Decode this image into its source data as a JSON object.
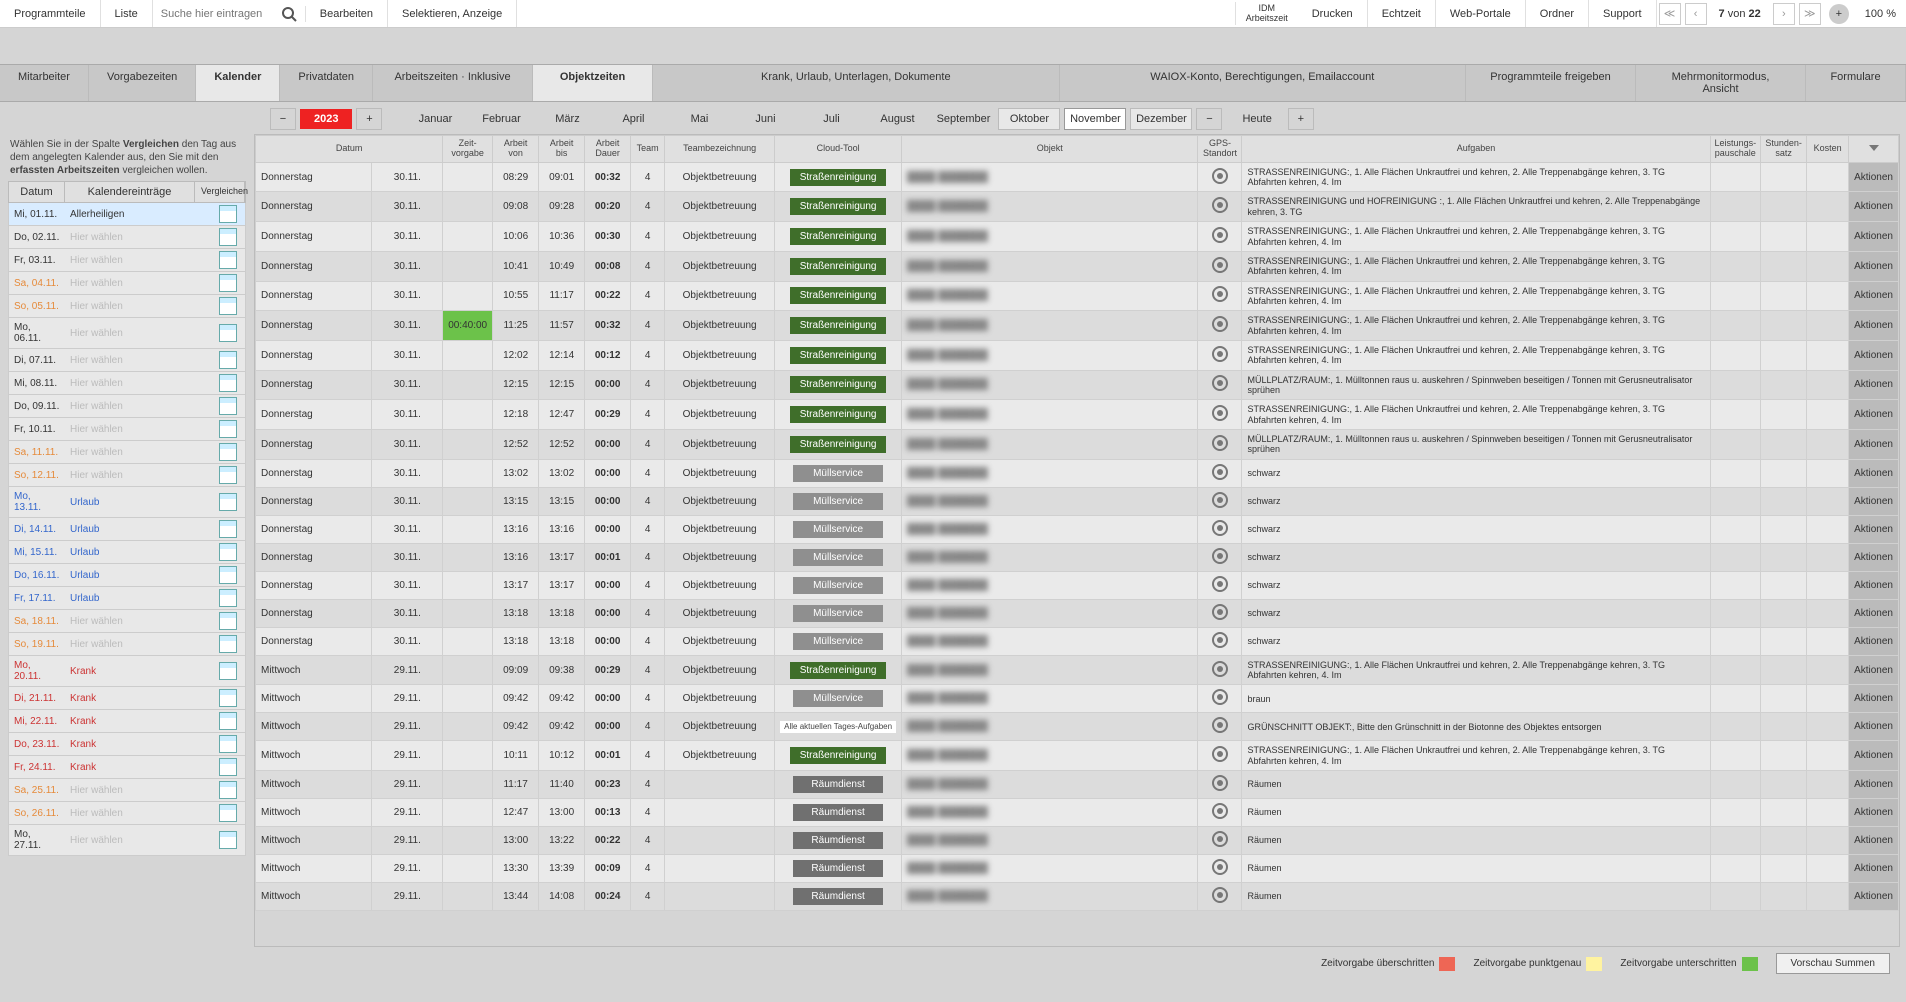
{
  "toolbar": {
    "programmteile": "Programmteile",
    "liste": "Liste",
    "search_placeholder": "Suche hier eintragen",
    "bearbeiten": "Bearbeiten",
    "selektieren": "Selektieren, Anzeige",
    "idm_line1": "IDM",
    "idm_line2": "Arbeitszeit",
    "drucken": "Drucken",
    "echtzeit": "Echtzeit",
    "webportale": "Web-Portale",
    "ordner": "Ordner",
    "support": "Support",
    "page_current": "7",
    "page_von": "von",
    "page_total": "22",
    "zoom": "100 %"
  },
  "tabs": {
    "mitarbeiter": "Mitarbeiter",
    "vorgabezeiten": "Vorgabezeiten",
    "kalender": "Kalender",
    "privatdaten": "Privatdaten",
    "arbeitszeiten": "Arbeitszeiten · Inklusive",
    "objektzeiten": "Objektzeiten",
    "krank": "Krank, Urlaub, Unterlagen, Dokumente",
    "waiox": "WAIOX-Konto, Berechtigungen, Emailaccount",
    "progfrei": "Programmteile freigeben",
    "mehrmonitor": "Mehrmonitormodus, Ansicht",
    "formulare": "Formulare"
  },
  "months": {
    "year": "2023",
    "januar": "Januar",
    "februar": "Februar",
    "maerz": "März",
    "april": "April",
    "mai": "Mai",
    "juni": "Juni",
    "juli": "Juli",
    "august": "August",
    "september": "September",
    "oktober": "Oktober",
    "november": "November",
    "dezember": "Dezember",
    "heute": "Heute"
  },
  "left": {
    "desc_pre": "Wählen Sie in der Spalte ",
    "desc_b1": "Vergleichen",
    "desc_mid": " den Tag aus dem angelegten Kalender aus, den Sie mit den ",
    "desc_b2": "erfassten Arbeitszeiten",
    "desc_post": " vergleichen wollen.",
    "col_datum": "Datum",
    "col_entry": "Kalendereinträge",
    "col_vgl": "Vergleichen",
    "hint": "Hier wählen",
    "rows": [
      {
        "d": "Mi, 01.11.",
        "e": "Allerheiligen",
        "cls": "",
        "hl": true
      },
      {
        "d": "Do, 02.11.",
        "e": "",
        "cls": ""
      },
      {
        "d": "Fr, 03.11.",
        "e": "",
        "cls": ""
      },
      {
        "d": "Sa, 04.11.",
        "e": "",
        "cls": "wkend"
      },
      {
        "d": "So, 05.11.",
        "e": "",
        "cls": "wkend"
      },
      {
        "d": "Mo, 06.11.",
        "e": "",
        "cls": ""
      },
      {
        "d": "Di, 07.11.",
        "e": "",
        "cls": ""
      },
      {
        "d": "Mi, 08.11.",
        "e": "",
        "cls": ""
      },
      {
        "d": "Do, 09.11.",
        "e": "",
        "cls": ""
      },
      {
        "d": "Fr, 10.11.",
        "e": "",
        "cls": ""
      },
      {
        "d": "Sa, 11.11.",
        "e": "",
        "cls": "wkend"
      },
      {
        "d": "So, 12.11.",
        "e": "",
        "cls": "wkend"
      },
      {
        "d": "Mo, 13.11.",
        "e": "Urlaub",
        "cls": "urlaub"
      },
      {
        "d": "Di, 14.11.",
        "e": "Urlaub",
        "cls": "urlaub"
      },
      {
        "d": "Mi, 15.11.",
        "e": "Urlaub",
        "cls": "urlaub"
      },
      {
        "d": "Do, 16.11.",
        "e": "Urlaub",
        "cls": "urlaub"
      },
      {
        "d": "Fr, 17.11.",
        "e": "Urlaub",
        "cls": "urlaub"
      },
      {
        "d": "Sa, 18.11.",
        "e": "",
        "cls": "wkend"
      },
      {
        "d": "So, 19.11.",
        "e": "",
        "cls": "wkend"
      },
      {
        "d": "Mo, 20.11.",
        "e": "Krank",
        "cls": "krank"
      },
      {
        "d": "Di, 21.11.",
        "e": "Krank",
        "cls": "krank"
      },
      {
        "d": "Mi, 22.11.",
        "e": "Krank",
        "cls": "krank"
      },
      {
        "d": "Do, 23.11.",
        "e": "Krank",
        "cls": "krank"
      },
      {
        "d": "Fr, 24.11.",
        "e": "Krank",
        "cls": "krank"
      },
      {
        "d": "Sa, 25.11.",
        "e": "",
        "cls": "wkend"
      },
      {
        "d": "So, 26.11.",
        "e": "",
        "cls": "wkend"
      },
      {
        "d": "Mo, 27.11.",
        "e": "",
        "cls": ""
      }
    ]
  },
  "hdr": {
    "datum": "Datum",
    "zvg": "Zeit-\nvorgabe",
    "avon": "Arbeit\nvon",
    "abis": "Arbeit\nbis",
    "adauer": "Arbeit\nDauer",
    "team": "Team",
    "teambez": "Teambezeichnung",
    "cloud": "Cloud-Tool",
    "objekt": "Objekt",
    "gps": "GPS-\nStandort",
    "aufgaben": "Aufgaben",
    "lp": "Leistungs-\npauschale",
    "ss": "Stunden-\nsatz",
    "kosten": "Kosten",
    "akt": "Aktionen"
  },
  "grid": {
    "rows": [
      {
        "tag": "Donnerstag",
        "dat": "30.11.",
        "zvg": "",
        "von": "08:29",
        "bis": "09:01",
        "dauer": "00:32",
        "team": "4",
        "tb": "Objektbetreuung",
        "tool": "strasse",
        "tool_lbl": "Straßenreinigung",
        "auf": "STRASSENREINIGUNG:, 1. Alle Flächen Unkrautfrei und kehren, 2. Alle Treppenabgänge kehren, 3. TG Abfahrten kehren, 4. Im"
      },
      {
        "tag": "Donnerstag",
        "dat": "30.11.",
        "zvg": "",
        "von": "09:08",
        "bis": "09:28",
        "dauer": "00:20",
        "team": "4",
        "tb": "Objektbetreuung",
        "tool": "strasse",
        "tool_lbl": "Straßenreinigung",
        "auf": "STRASSENREINIGUNG und HOFREINIGUNG :, 1. Alle Flächen Unkrautfrei und kehren, 2. Alle Treppenabgänge kehren, 3. TG"
      },
      {
        "tag": "Donnerstag",
        "dat": "30.11.",
        "zvg": "",
        "von": "10:06",
        "bis": "10:36",
        "dauer": "00:30",
        "team": "4",
        "tb": "Objektbetreuung",
        "tool": "strasse",
        "tool_lbl": "Straßenreinigung",
        "auf": "STRASSENREINIGUNG:, 1. Alle Flächen Unkrautfrei und kehren, 2. Alle Treppenabgänge kehren, 3. TG Abfahrten kehren, 4. Im"
      },
      {
        "tag": "Donnerstag",
        "dat": "30.11.",
        "zvg": "",
        "von": "10:41",
        "bis": "10:49",
        "dauer": "00:08",
        "team": "4",
        "tb": "Objektbetreuung",
        "tool": "strasse",
        "tool_lbl": "Straßenreinigung",
        "auf": "STRASSENREINIGUNG:, 1. Alle Flächen Unkrautfrei und kehren, 2. Alle Treppenabgänge kehren, 3. TG Abfahrten kehren, 4. Im"
      },
      {
        "tag": "Donnerstag",
        "dat": "30.11.",
        "zvg": "",
        "von": "10:55",
        "bis": "11:17",
        "dauer": "00:22",
        "team": "4",
        "tb": "Objektbetreuung",
        "tool": "strasse",
        "tool_lbl": "Straßenreinigung",
        "auf": "STRASSENREINIGUNG:, 1. Alle Flächen Unkrautfrei und kehren, 2. Alle Treppenabgänge kehren, 3. TG Abfahrten kehren, 4. Im"
      },
      {
        "tag": "Donnerstag",
        "dat": "30.11.",
        "zvg": "00:40:00",
        "von": "11:25",
        "bis": "11:57",
        "dauer": "00:32",
        "team": "4",
        "tb": "Objektbetreuung",
        "tool": "strasse",
        "tool_lbl": "Straßenreinigung",
        "auf": "STRASSENREINIGUNG:, 1. Alle Flächen Unkrautfrei und kehren, 2. Alle Treppenabgänge kehren, 3. TG Abfahrten kehren, 4. Im",
        "zvghl": true
      },
      {
        "tag": "Donnerstag",
        "dat": "30.11.",
        "zvg": "",
        "von": "12:02",
        "bis": "12:14",
        "dauer": "00:12",
        "team": "4",
        "tb": "Objektbetreuung",
        "tool": "strasse",
        "tool_lbl": "Straßenreinigung",
        "auf": "STRASSENREINIGUNG:, 1. Alle Flächen Unkrautfrei und kehren, 2. Alle Treppenabgänge kehren, 3. TG Abfahrten kehren, 4. Im"
      },
      {
        "tag": "Donnerstag",
        "dat": "30.11.",
        "zvg": "",
        "von": "12:15",
        "bis": "12:15",
        "dauer": "00:00",
        "team": "4",
        "tb": "Objektbetreuung",
        "tool": "strasse",
        "tool_lbl": "Straßenreinigung",
        "auf": "MÜLLPLATZ/RAUM:, 1. Mülltonnen raus u. auskehren / Spinnweben beseitigen / Tonnen mit Gerusneutralisator sprühen"
      },
      {
        "tag": "Donnerstag",
        "dat": "30.11.",
        "zvg": "",
        "von": "12:18",
        "bis": "12:47",
        "dauer": "00:29",
        "team": "4",
        "tb": "Objektbetreuung",
        "tool": "strasse",
        "tool_lbl": "Straßenreinigung",
        "auf": "STRASSENREINIGUNG:, 1. Alle Flächen Unkrautfrei und kehren, 2. Alle Treppenabgänge kehren, 3. TG Abfahrten kehren, 4. Im"
      },
      {
        "tag": "Donnerstag",
        "dat": "30.11.",
        "zvg": "",
        "von": "12:52",
        "bis": "12:52",
        "dauer": "00:00",
        "team": "4",
        "tb": "Objektbetreuung",
        "tool": "strasse",
        "tool_lbl": "Straßenreinigung",
        "auf": "MÜLLPLATZ/RAUM:, 1. Mülltonnen raus u. auskehren / Spinnweben beseitigen / Tonnen mit Gerusneutralisator sprühen"
      },
      {
        "tag": "Donnerstag",
        "dat": "30.11.",
        "zvg": "",
        "von": "13:02",
        "bis": "13:02",
        "dauer": "00:00",
        "team": "4",
        "tb": "Objektbetreuung",
        "tool": "mull",
        "tool_lbl": "Müllservice",
        "auf": "schwarz"
      },
      {
        "tag": "Donnerstag",
        "dat": "30.11.",
        "zvg": "",
        "von": "13:15",
        "bis": "13:15",
        "dauer": "00:00",
        "team": "4",
        "tb": "Objektbetreuung",
        "tool": "mull",
        "tool_lbl": "Müllservice",
        "auf": "schwarz"
      },
      {
        "tag": "Donnerstag",
        "dat": "30.11.",
        "zvg": "",
        "von": "13:16",
        "bis": "13:16",
        "dauer": "00:00",
        "team": "4",
        "tb": "Objektbetreuung",
        "tool": "mull",
        "tool_lbl": "Müllservice",
        "auf": "schwarz"
      },
      {
        "tag": "Donnerstag",
        "dat": "30.11.",
        "zvg": "",
        "von": "13:16",
        "bis": "13:17",
        "dauer": "00:01",
        "team": "4",
        "tb": "Objektbetreuung",
        "tool": "mull",
        "tool_lbl": "Müllservice",
        "auf": "schwarz"
      },
      {
        "tag": "Donnerstag",
        "dat": "30.11.",
        "zvg": "",
        "von": "13:17",
        "bis": "13:17",
        "dauer": "00:00",
        "team": "4",
        "tb": "Objektbetreuung",
        "tool": "mull",
        "tool_lbl": "Müllservice",
        "auf": "schwarz"
      },
      {
        "tag": "Donnerstag",
        "dat": "30.11.",
        "zvg": "",
        "von": "13:18",
        "bis": "13:18",
        "dauer": "00:00",
        "team": "4",
        "tb": "Objektbetreuung",
        "tool": "mull",
        "tool_lbl": "Müllservice",
        "auf": "schwarz"
      },
      {
        "tag": "Donnerstag",
        "dat": "30.11.",
        "zvg": "",
        "von": "13:18",
        "bis": "13:18",
        "dauer": "00:00",
        "team": "4",
        "tb": "Objektbetreuung",
        "tool": "mull",
        "tool_lbl": "Müllservice",
        "auf": "schwarz"
      },
      {
        "tag": "Mittwoch",
        "dat": "29.11.",
        "zvg": "",
        "von": "09:09",
        "bis": "09:38",
        "dauer": "00:29",
        "team": "4",
        "tb": "Objektbetreuung",
        "tool": "strasse",
        "tool_lbl": "Straßenreinigung",
        "auf": "STRASSENREINIGUNG:, 1. Alle Flächen Unkrautfrei und kehren, 2. Alle Treppenabgänge kehren, 3. TG Abfahrten kehren, 4. Im"
      },
      {
        "tag": "Mittwoch",
        "dat": "29.11.",
        "zvg": "",
        "von": "09:42",
        "bis": "09:42",
        "dauer": "00:00",
        "team": "4",
        "tb": "Objektbetreuung",
        "tool": "mull",
        "tool_lbl": "Müllservice",
        "auf": "braun"
      },
      {
        "tag": "Mittwoch",
        "dat": "29.11.",
        "zvg": "",
        "von": "09:42",
        "bis": "09:42",
        "dauer": "00:00",
        "team": "4",
        "tb": "Objektbetreuung",
        "tool": "white",
        "tool_lbl": "Alle aktuellen Tages-Aufgaben",
        "auf": "GRÜNSCHNITT OBJEKT:, Bitte den Grünschnitt in der Biotonne des Objektes entsorgen"
      },
      {
        "tag": "Mittwoch",
        "dat": "29.11.",
        "zvg": "",
        "von": "10:11",
        "bis": "10:12",
        "dauer": "00:01",
        "team": "4",
        "tb": "Objektbetreuung",
        "tool": "strasse",
        "tool_lbl": "Straßenreinigung",
        "auf": "STRASSENREINIGUNG:, 1. Alle Flächen Unkrautfrei und kehren, 2. Alle Treppenabgänge kehren, 3. TG Abfahrten kehren, 4. Im"
      },
      {
        "tag": "Mittwoch",
        "dat": "29.11.",
        "zvg": "",
        "von": "11:17",
        "bis": "11:40",
        "dauer": "00:23",
        "team": "4",
        "tb": "",
        "tool": "raum",
        "tool_lbl": "Räumdienst",
        "auf": "Räumen"
      },
      {
        "tag": "Mittwoch",
        "dat": "29.11.",
        "zvg": "",
        "von": "12:47",
        "bis": "13:00",
        "dauer": "00:13",
        "team": "4",
        "tb": "",
        "tool": "raum",
        "tool_lbl": "Räumdienst",
        "auf": "Räumen"
      },
      {
        "tag": "Mittwoch",
        "dat": "29.11.",
        "zvg": "",
        "von": "13:00",
        "bis": "13:22",
        "dauer": "00:22",
        "team": "4",
        "tb": "",
        "tool": "raum",
        "tool_lbl": "Räumdienst",
        "auf": "Räumen"
      },
      {
        "tag": "Mittwoch",
        "dat": "29.11.",
        "zvg": "",
        "von": "13:30",
        "bis": "13:39",
        "dauer": "00:09",
        "team": "4",
        "tb": "",
        "tool": "raum",
        "tool_lbl": "Räumdienst",
        "auf": "Räumen"
      },
      {
        "tag": "Mittwoch",
        "dat": "29.11.",
        "zvg": "",
        "von": "13:44",
        "bis": "14:08",
        "dauer": "00:24",
        "team": "4",
        "tb": "",
        "tool": "raum",
        "tool_lbl": "Räumdienst",
        "auf": "Räumen"
      }
    ]
  },
  "legend": {
    "ueber": "Zeitvorgabe überschritten",
    "punkt": "Zeitvorgabe punktgenau",
    "unter": "Zeitvorgabe unterschritten",
    "preview": "Vorschau Summen"
  },
  "actions_label": "Aktionen"
}
